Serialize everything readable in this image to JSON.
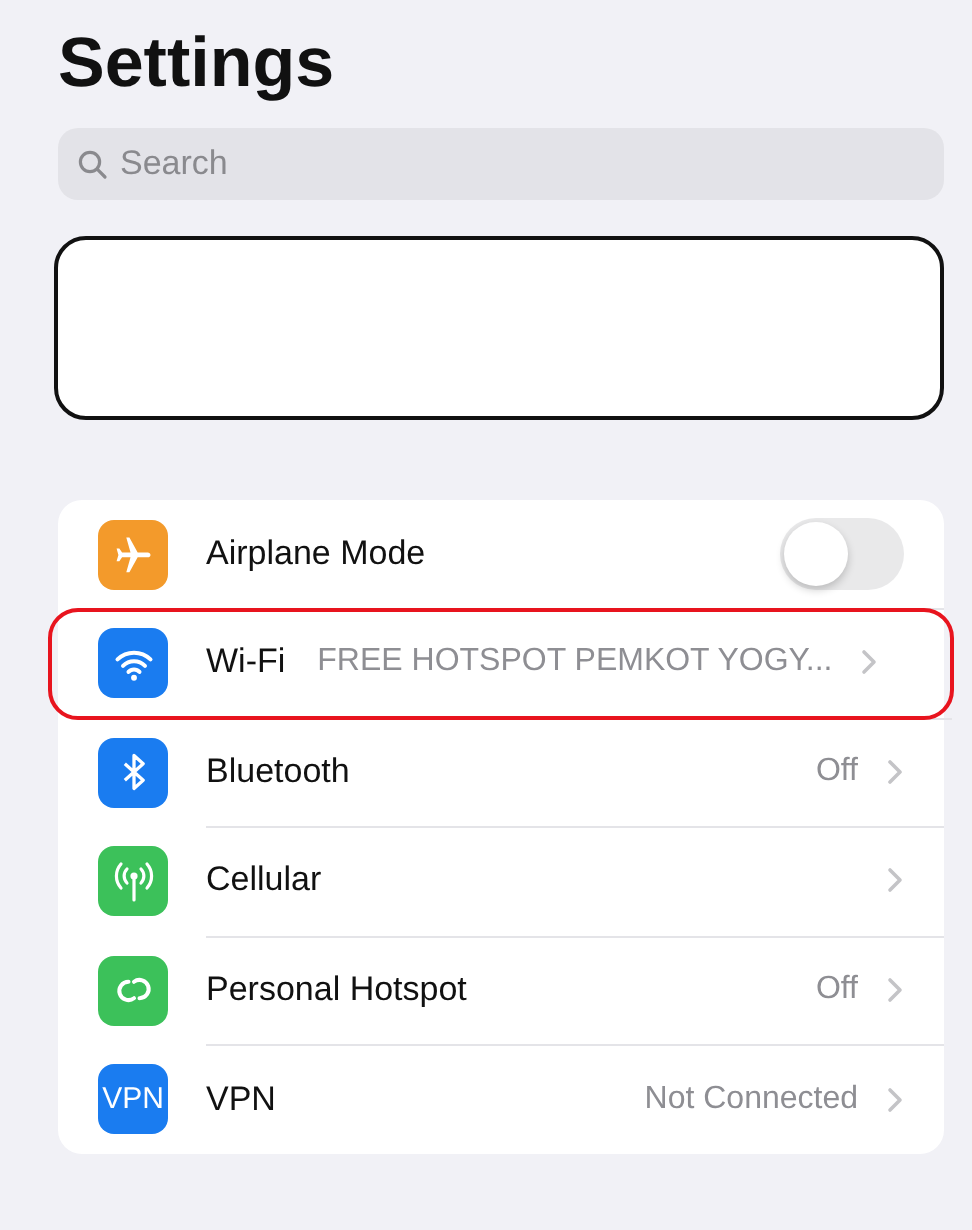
{
  "title": "Settings",
  "search": {
    "placeholder": "Search"
  },
  "profile_card": {
    "redacted": true
  },
  "rows": [
    {
      "kind": "toggle",
      "label": "Airplane Mode",
      "color": "#f39a2b",
      "on": false,
      "highlighted": false
    },
    {
      "kind": "link",
      "label": "Wi-Fi",
      "value": "FREE HOTSPOT PEMKOT YOGY...",
      "color": "#1a7cf0",
      "highlighted": true
    },
    {
      "kind": "link",
      "label": "Bluetooth",
      "value": "Off",
      "color": "#1a7cf0",
      "highlighted": false
    },
    {
      "kind": "link",
      "label": "Cellular",
      "color": "#3cc15a",
      "highlighted": false
    },
    {
      "kind": "link",
      "label": "Personal Hotspot",
      "value": "Off",
      "color": "#3cc15a",
      "highlighted": false
    },
    {
      "kind": "link",
      "label": "VPN",
      "value": "Not Connected",
      "icon_text": "VPN",
      "color": "#1a7cf0",
      "highlighted": false
    }
  ]
}
